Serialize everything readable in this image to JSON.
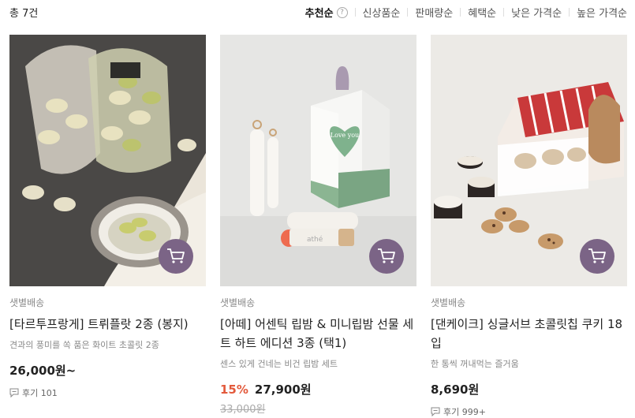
{
  "header": {
    "total": "총 7건",
    "sorts": [
      "추천순",
      "신상품순",
      "판매량순",
      "혜택순",
      "낮은 가격순",
      "높은 가격순"
    ],
    "help": "?"
  },
  "products": [
    {
      "shipping": "샛별배송",
      "title": "[타르투프랑게] 트뤼플랏 2종 (봉지)",
      "desc": "견과의 풍미를 쏙 품은 화이트 초콜릿 2종",
      "price": "26,000원~",
      "review": "후기 101"
    },
    {
      "shipping": "샛별배송",
      "title": "[아떼] 어센틱 립밤 & 미니립밤 선물 세트 하트 에디션 3종 (택1)",
      "desc": "센스 있게 건네는 비건 립밤 세트",
      "discount": "15%",
      "price": "27,900원",
      "original_price": "33,000원",
      "box_text": "Love you",
      "brand": "athé"
    },
    {
      "shipping": "샛별배송",
      "title": "[댄케이크] 싱글서브 초콜릿칩 쿠키 18입",
      "desc": "한 통씩 꺼내먹는 즐거움",
      "price": "8,690원",
      "review": "후기 999+"
    }
  ],
  "colors": {
    "cart": "#7b6486",
    "discount": "#e35a3c"
  }
}
